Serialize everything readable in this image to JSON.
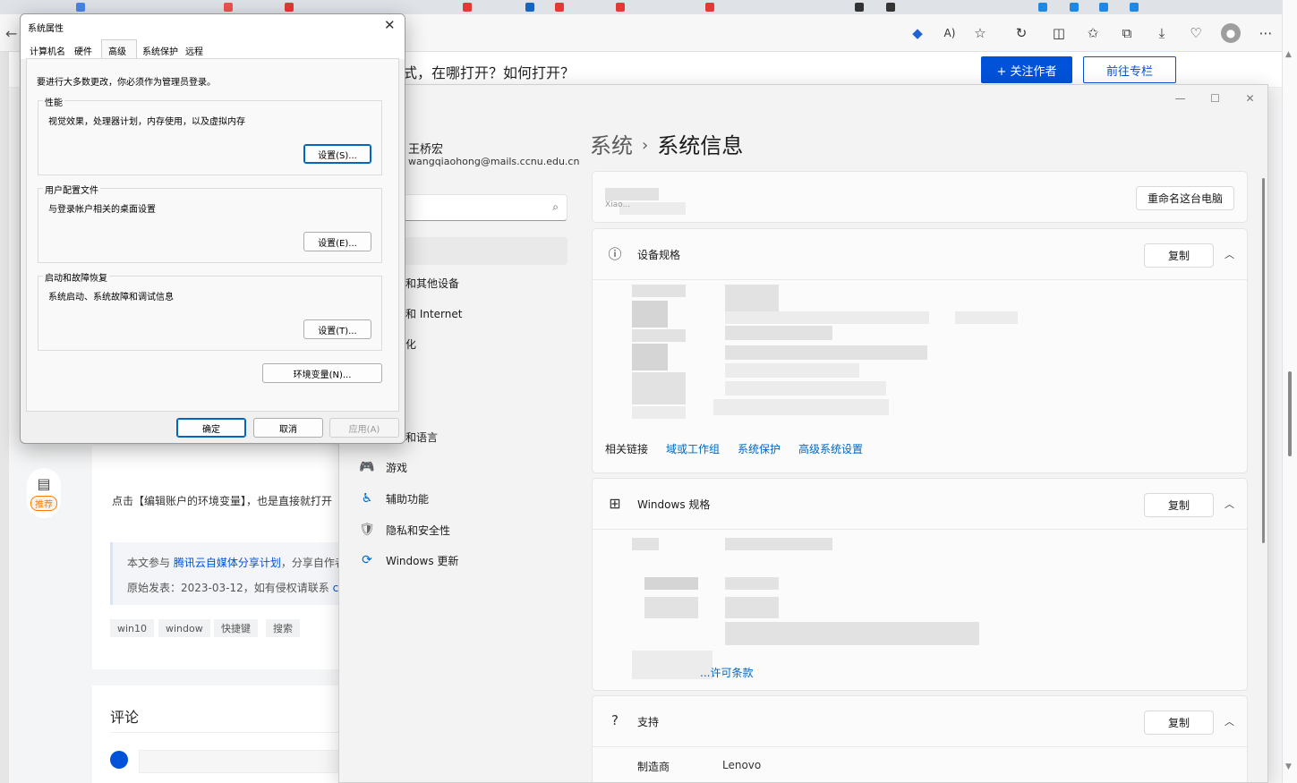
{
  "browser": {
    "right_scroll_up": "▲",
    "right_scroll_down": "▼"
  },
  "article": {
    "title_fragment": "式，在哪打开？如何打开？",
    "follow_button": "+ 关注作者",
    "column_button": "前往专栏",
    "recommend_badge": "推荐",
    "body_text": "点击【编辑账户的环境变量】，也是直接就打开",
    "source_line1_prefix": "本文参与 ",
    "source_line1_link": "腾讯云自媒体分享计划",
    "source_line1_suffix": "，分享自作者",
    "source_line2_prefix": "原始发表：2023-03-12，如有侵权请联系 ",
    "source_line2_link": "clo",
    "tags": [
      "win10",
      "window",
      "快捷键",
      "搜索"
    ],
    "comment_title": "评论"
  },
  "settings": {
    "user_name": "王桥宏",
    "user_email": "wangqiaohong@mails.ccnu.edu.cn",
    "nav_items": [
      {
        "label": "和其他设备",
        "icon": ""
      },
      {
        "label": "和 Internet",
        "icon": ""
      },
      {
        "label": "化",
        "icon": ""
      },
      {
        "label": "和语言",
        "icon": ""
      },
      {
        "label": "游戏",
        "icon": "🎮"
      },
      {
        "label": "辅助功能",
        "icon": "♿"
      },
      {
        "label": "隐私和安全性",
        "icon": "🛡"
      },
      {
        "label": "Windows 更新",
        "icon": "⟳"
      }
    ],
    "breadcrumb_parent": "系统",
    "breadcrumb_separator": "›",
    "breadcrumb_current": "系统信息",
    "pc_name_fragment": "Xiao...",
    "rename_button": "重命名这台电脑",
    "device_specs_title": "设备规格",
    "copy_button": "复制",
    "related_links_label": "相关链接",
    "related_links": [
      "域或工作组",
      "系统保护",
      "高级系统设置"
    ],
    "windows_spec_title": "Windows 规格",
    "license_fragment": "...许可条款",
    "support_title": "支持",
    "support_rows": [
      {
        "label": "制造商",
        "value": "Lenovo"
      }
    ]
  },
  "sysprops": {
    "title": "系统属性",
    "tabs": [
      "计算机名",
      "硬件",
      "高级",
      "系统保护",
      "远程"
    ],
    "active_tab": "高级",
    "admin_note": "要进行大多数更改，你必须作为管理员登录。",
    "groups": [
      {
        "title": "性能",
        "desc": "视觉效果，处理器计划，内存使用，以及虚拟内存",
        "button": "设置(S)..."
      },
      {
        "title": "用户配置文件",
        "desc": "与登录帐户相关的桌面设置",
        "button": "设置(E)..."
      },
      {
        "title": "启动和故障恢复",
        "desc": "系统启动、系统故障和调试信息",
        "button": "设置(T)..."
      }
    ],
    "env_button": "环境变量(N)...",
    "ok_button": "确定",
    "cancel_button": "取消",
    "apply_button": "应用(A)"
  },
  "colors": {
    "accent_blue": "#0052d9",
    "windows_link": "#0067c0"
  }
}
